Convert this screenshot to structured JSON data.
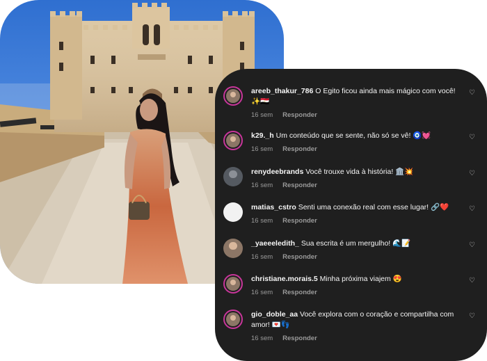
{
  "comments": [
    {
      "user": "areeb_thakur_786",
      "text": "O Egito ficou ainda mais mágico com você! ✨🇪🇬",
      "time": "16 sem",
      "reply": "Responder",
      "avatar": "photo"
    },
    {
      "user": "k29._h",
      "text": "Um conteúdo que se sente, não só se vê! 🧿💓",
      "time": "16 sem",
      "reply": "Responder",
      "avatar": "photo"
    },
    {
      "user": "renydeebrands",
      "text": "Você trouxe vida à história! 🏛️💥",
      "time": "16 sem",
      "reply": "Responder",
      "avatar": "gray"
    },
    {
      "user": "matias_cstro",
      "text": "Senti uma conexão real com esse lugar! 🔗❤️",
      "time": "16 sem",
      "reply": "Responder",
      "avatar": "white"
    },
    {
      "user": "_yaeeeledith_",
      "text": "Sua escrita é um mergulho! 🌊📝",
      "time": "16 sem",
      "reply": "Responder",
      "avatar": "photo"
    },
    {
      "user": "christiane.morais.5",
      "text": "Minha próxima viajem 😍",
      "time": "16 sem",
      "reply": "Responder",
      "avatar": "photo"
    },
    {
      "user": "gio_doble_aa",
      "text": "Você explora com o coração e compartilha com amor! 💌👣",
      "time": "16 sem",
      "reply": "Responder",
      "avatar": "photo"
    }
  ],
  "colors": {
    "card_bg": "#1f1f1f",
    "text": "#f5f5f5",
    "meta": "#9b9b9b",
    "avatar_ring": "#c8369a"
  }
}
